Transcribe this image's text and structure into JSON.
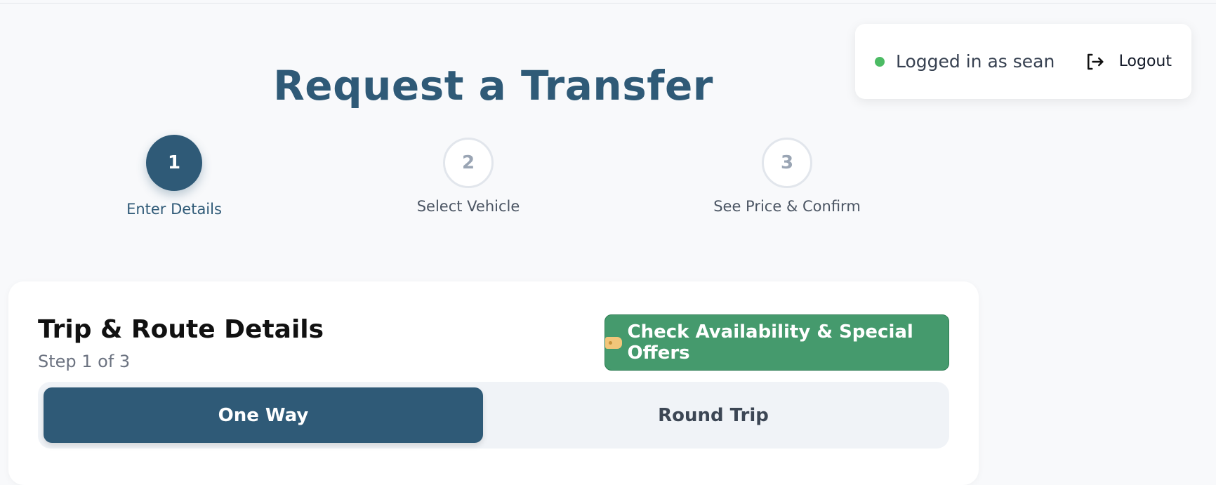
{
  "user": {
    "status_text": "Logged in as sean",
    "logout_label": "Logout",
    "status_color": "#4cbb64"
  },
  "page": {
    "title": "Request a Transfer"
  },
  "steps": [
    {
      "number": "1",
      "label": "Enter Details",
      "state": "active"
    },
    {
      "number": "2",
      "label": "Select Vehicle",
      "state": "inactive"
    },
    {
      "number": "3",
      "label": "See Price & Confirm",
      "state": "inactive"
    }
  ],
  "form": {
    "title": "Trip & Route Details",
    "subtitle": "Step 1 of 3",
    "offers_button": "Check Availability & Special Offers",
    "offers_icon": "tag-icon",
    "trip_types": [
      {
        "label": "One Way",
        "selected": true
      },
      {
        "label": "Round Trip",
        "selected": false
      }
    ]
  },
  "colors": {
    "primary": "#2f5a77",
    "success": "#459a6d",
    "background": "#f8f9fb"
  }
}
